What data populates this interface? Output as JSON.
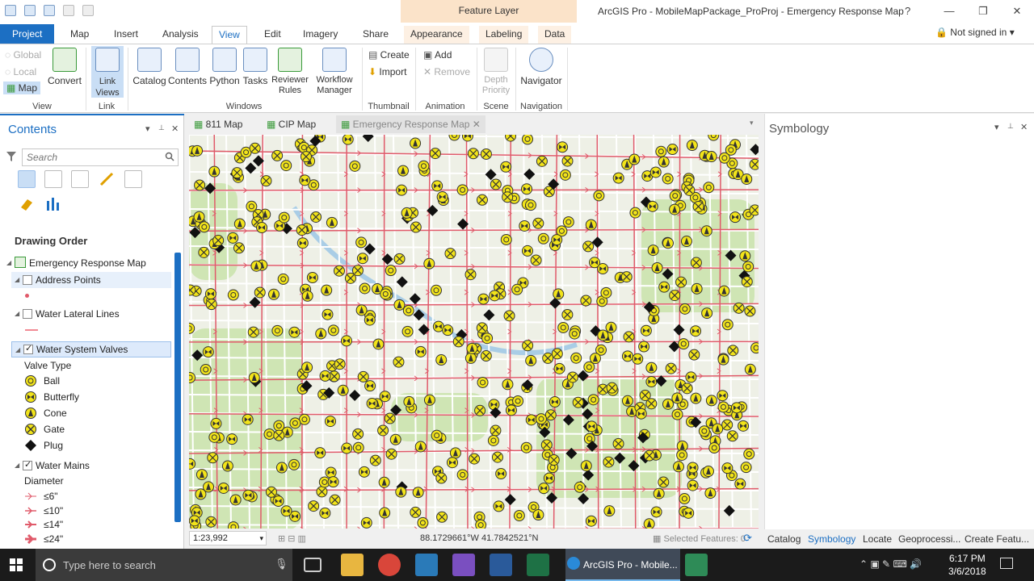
{
  "window": {
    "title": "ArcGIS Pro - MobileMapPackage_ProProj - Emergency Response Map",
    "context_tab": "Feature Layer",
    "help": "?",
    "controls": {
      "minimize": "—",
      "restore": "❐",
      "close": "✕"
    }
  },
  "ribbon_tabs": [
    "Project",
    "Map",
    "Insert",
    "Analysis",
    "View",
    "Edit",
    "Imagery",
    "Share",
    "Appearance",
    "Labeling",
    "Data"
  ],
  "account": {
    "label": "Not signed in",
    "arrow": "▾"
  },
  "ribbon": {
    "view_group": {
      "global": "Global",
      "local": "Local",
      "map": "Map",
      "convert": "Convert",
      "label": "View"
    },
    "link_group": {
      "link_views": "Link Views",
      "label": "Link"
    },
    "windows_group": {
      "catalog": "Catalog",
      "contents": "Contents",
      "python": "Python",
      "tasks": "Tasks",
      "reviewer_rules": "Reviewer Rules",
      "workflow_manager": "Workflow Manager",
      "label": "Windows"
    },
    "thumbnail_group": {
      "create": "Create",
      "import": "Import",
      "label": "Thumbnail"
    },
    "animation_group": {
      "add": "Add",
      "remove": "Remove",
      "label": "Animation"
    },
    "scene_group": {
      "depth_priority": "Depth Priority",
      "label": "Scene"
    },
    "navigation_group": {
      "navigator": "Navigator",
      "label": "Navigation"
    }
  },
  "contents": {
    "title": "Contents",
    "pane_controls": {
      "dropdown": "▾",
      "pin": "📌",
      "close": "✕"
    },
    "search_placeholder": "Search",
    "drawing_order": "Drawing Order",
    "map_name": "Emergency Response Map",
    "layers": [
      {
        "name": "Address Points",
        "checked": false
      },
      {
        "name": "Water Lateral Lines",
        "checked": false
      },
      {
        "name": "Water System Valves",
        "checked": true
      },
      {
        "name": "Water Mains",
        "checked": true
      }
    ],
    "valve_legend": {
      "title": "Valve Type",
      "items": [
        "Ball",
        "Butterfly",
        "Cone",
        "Gate",
        "Plug"
      ]
    },
    "mains_legend": {
      "title": "Diameter",
      "items": [
        "≤6\"",
        "≤10\"",
        "≤14\"",
        "≤24\""
      ]
    }
  },
  "map_tabs": [
    {
      "label": "811 Map"
    },
    {
      "label": "CIP Map"
    },
    {
      "label": "Emergency Response Map"
    }
  ],
  "map_status": {
    "scale": "1:23,992",
    "coords": "88.1729661°W 41.7842521°N",
    "selected": "Selected Features: 0"
  },
  "symbology": {
    "title": "Symbology"
  },
  "bottom_tabs": [
    "Catalog",
    "Symbology",
    "Locate",
    "Geoprocessi...",
    "Create Featu..."
  ],
  "taskbar": {
    "search_placeholder": "Type here to search",
    "active_app": "ArcGIS Pro - Mobile...",
    "time": "6:17 PM",
    "date": "3/6/2018"
  },
  "colors": {
    "accent": "#1c6fc3",
    "valve_fill": "#f2e41a",
    "main_line": "#e05a6a"
  }
}
